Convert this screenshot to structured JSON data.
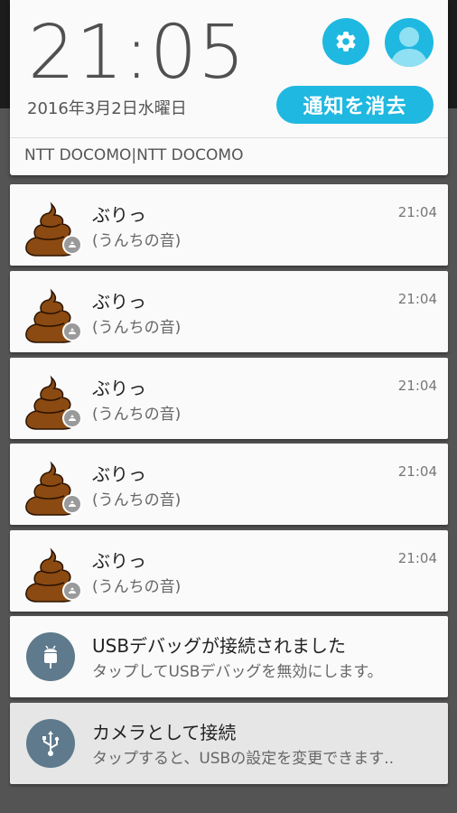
{
  "header": {
    "clock": "21:05",
    "date": "2016年3月2日水曜日",
    "clear_label": "通知を消去",
    "carrier": "NTT DOCOMO|NTT DOCOMO",
    "accent_color": "#1fb8e0"
  },
  "notifications": [
    {
      "title": "ぶりっ",
      "text": "(うんちの音)",
      "time": "21:04",
      "icon": "poop-icon"
    },
    {
      "title": "ぶりっ",
      "text": "(うんちの音)",
      "time": "21:04",
      "icon": "poop-icon"
    },
    {
      "title": "ぶりっ",
      "text": "(うんちの音)",
      "time": "21:04",
      "icon": "poop-icon"
    },
    {
      "title": "ぶりっ",
      "text": "(うんちの音)",
      "time": "21:04",
      "icon": "poop-icon"
    },
    {
      "title": "ぶりっ",
      "text": "(うんちの音)",
      "time": "21:04",
      "icon": "poop-icon"
    }
  ],
  "system_notifications": [
    {
      "title": "USBデバッグが接続されました",
      "text": "タップしてUSBデバッグを無効にします。",
      "icon": "android-debug-icon"
    },
    {
      "title": "カメラとして接続",
      "text": "タップすると、USBの設定を変更できます..",
      "icon": "usb-icon"
    }
  ]
}
